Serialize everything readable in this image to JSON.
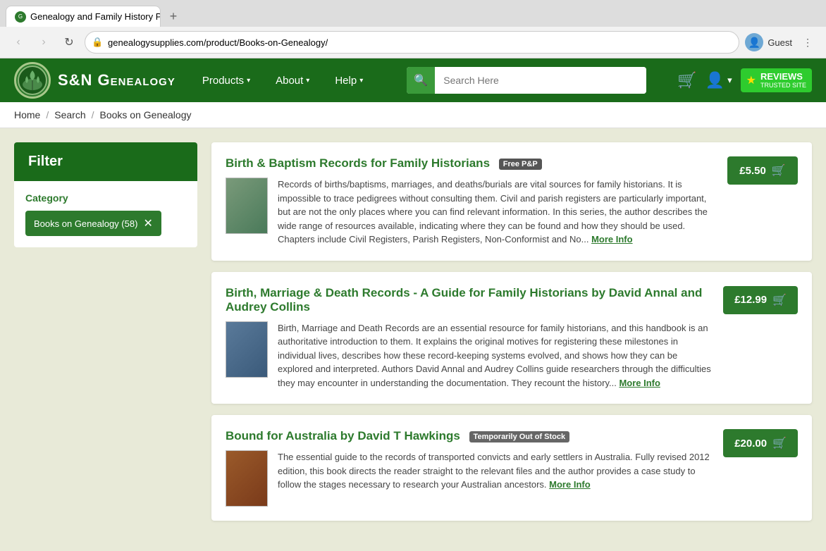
{
  "browser": {
    "tab_title": "Genealogy and Family History P...",
    "tab_close": "×",
    "tab_new": "+",
    "back_btn": "‹",
    "forward_btn": "›",
    "refresh_btn": "↻",
    "url": "genealogysupplies.com/product/Books-on-Genealogy/",
    "user_label": "Guest",
    "menu_dots": "⋮"
  },
  "header": {
    "logo_text": "S&N Genealogy",
    "nav": [
      {
        "label": "Products",
        "arrow": "▾"
      },
      {
        "label": "About",
        "arrow": "▾"
      },
      {
        "label": "Help",
        "arrow": "▾"
      }
    ],
    "search_placeholder": "Search Here",
    "reviews_label": "REVIEWS",
    "reviews_sub": "TRUSTED SITE",
    "reviews_star": "★"
  },
  "breadcrumb": {
    "home": "Home",
    "search": "Search",
    "current": "Books on Genealogy"
  },
  "filter": {
    "title": "Filter",
    "category_label": "Category",
    "tag_label": "Books on Genealogy (58)",
    "tag_remove": "✕"
  },
  "products": [
    {
      "title": "Birth & Baptism Records for Family Historians",
      "badge": "Free P&P",
      "badge_type": "free-pp",
      "price": "£5.50",
      "description": "Records of births/baptisms, marriages, and deaths/burials are vital sources for family historians. It is impossible to trace pedigrees without consulting them. Civil and parish registers are particularly important, but are not the only places where you can find relevant information. In this series, the author describes the wide range of resources available, indicating where they can be found and how they should be used. Chapters include Civil Registers, Parish Registers, Non-Conformist and No...",
      "more_link": "More Info",
      "cover_class": "book-cover-1"
    },
    {
      "title": "Birth, Marriage & Death Records - A Guide for Family Historians by David Annal and Audrey Collins",
      "badge": "",
      "badge_type": "",
      "price": "£12.99",
      "description": "Birth, Marriage and Death Records are an essential resource for family historians, and this handbook is an authoritative introduction to them. It explains the original motives for registering these milestones in individual lives, describes how these record-keeping systems evolved, and shows how they can be explored and interpreted. Authors David Annal and Audrey Collins guide researchers through the difficulties they may encounter in understanding the documentation. They recount the history...",
      "more_link": "More Info",
      "cover_class": "book-cover-2"
    },
    {
      "title": "Bound for Australia by David T Hawkings",
      "badge": "Temporarily Out of Stock",
      "badge_type": "out-of-stock",
      "price": "£20.00",
      "description": "The essential guide to the records of transported convicts and early settlers in Australia. Fully revised 2012 edition, this book directs the reader straight to the relevant files and the author provides a case study to follow the stages necessary to research your Australian ancestors.",
      "more_link": "More Info",
      "cover_class": "book-cover-3"
    }
  ]
}
